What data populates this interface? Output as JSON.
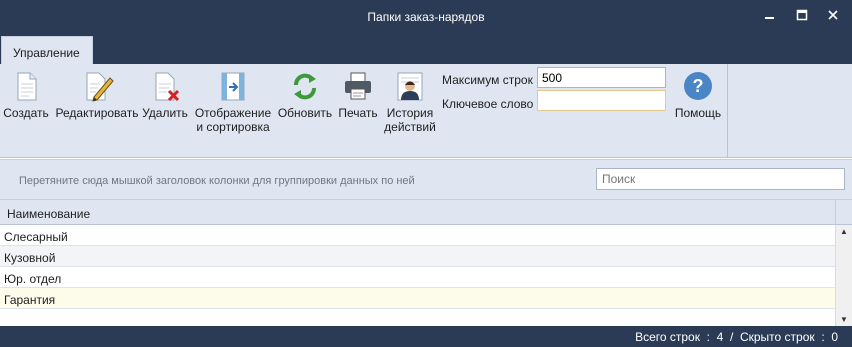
{
  "window": {
    "title": "Папки заказ-нарядов",
    "min_glyph": "▁",
    "max_glyph": "☐",
    "close_glyph": "✕"
  },
  "tabs": [
    {
      "label": "Управление",
      "active": true
    }
  ],
  "toolbar": {
    "buttons": [
      {
        "label": "Создать",
        "icon": "new-document-icon"
      },
      {
        "label": "Редактировать",
        "icon": "edit-pencil-icon"
      },
      {
        "label": "Удалить",
        "icon": "delete-document-icon"
      },
      {
        "label": "Отображение\nи сортировка",
        "icon": "display-sort-icon"
      },
      {
        "label": "Обновить",
        "icon": "refresh-icon"
      },
      {
        "label": "Печать",
        "icon": "printer-icon"
      },
      {
        "label": "История\nдействий",
        "icon": "history-user-icon"
      },
      {
        "label": "Помощь",
        "icon": "help-icon"
      }
    ],
    "max_rows_label": "Максимум строк",
    "max_rows_value": "500",
    "keyword_label": "Ключевое слово",
    "keyword_value": ""
  },
  "grouping": {
    "hint": "Перетяните сюда мышкой заголовок колонки для группировки данных по ней",
    "search_placeholder": "Поиск"
  },
  "grid": {
    "columns": [
      "Наименование"
    ],
    "rows": [
      {
        "name": "Слесарный"
      },
      {
        "name": "Кузовной"
      },
      {
        "name": "Юр. отдел"
      },
      {
        "name": "Гарантия"
      }
    ],
    "selected_row": 3
  },
  "status": {
    "text": "Всего строк  :  4  /  Скрыто строк  :  0"
  },
  "colors": {
    "title_bar": "#2b3a55",
    "ribbon": "#dfe6f1",
    "selected_row": "#fdfbe9",
    "refresh_green": "#3c9a3c",
    "help_blue": "#4a86c5",
    "delete_red": "#d42020"
  }
}
